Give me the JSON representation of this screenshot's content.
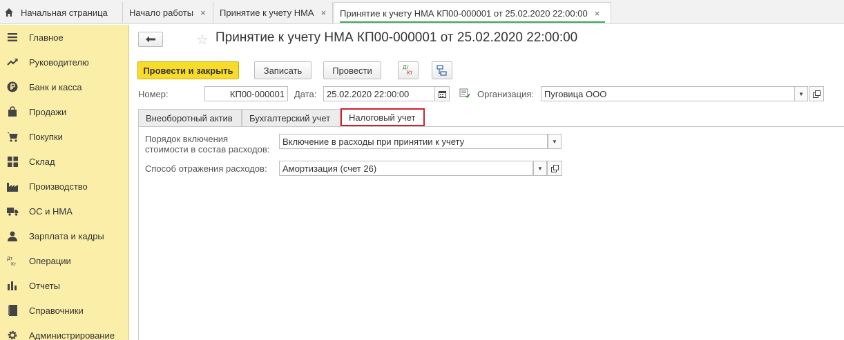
{
  "tabs": {
    "home": "Начальная страница",
    "start": "Начало работы",
    "acceptance": "Принятие к учету НМА",
    "current": "Принятие к учету НМА КП00-000001 от 25.02.2020 22:00:00",
    "close": "×"
  },
  "sidebar": {
    "items": [
      {
        "label": "Главное",
        "icon": "menu-icon"
      },
      {
        "label": "Руководителю",
        "icon": "trend-icon"
      },
      {
        "label": "Банк и касса",
        "icon": "ruble-icon"
      },
      {
        "label": "Продажи",
        "icon": "bag-icon"
      },
      {
        "label": "Покупки",
        "icon": "cart-icon"
      },
      {
        "label": "Склад",
        "icon": "grid-icon"
      },
      {
        "label": "Производство",
        "icon": "factory-icon"
      },
      {
        "label": "ОС и НМА",
        "icon": "truck-icon"
      },
      {
        "label": "Зарплата и кадры",
        "icon": "person-icon"
      },
      {
        "label": "Операции",
        "icon": "dt-kt-icon"
      },
      {
        "label": "Отчеты",
        "icon": "bar-chart-icon"
      },
      {
        "label": "Справочники",
        "icon": "book-icon"
      },
      {
        "label": "Администрирование",
        "icon": "gear-icon"
      }
    ]
  },
  "document": {
    "title": "Принятие к учету НМА КП00-000001 от 25.02.2020 22:00:00"
  },
  "toolbar": {
    "post_close": "Провести и закрыть",
    "save": "Записать",
    "post": "Провести",
    "dtkt_top": "Дт",
    "dtkt_bottom": "Кт"
  },
  "header_fields": {
    "number_label": "Номер:",
    "number_value": "КП00-000001",
    "date_label": "Дата:",
    "date_value": "25.02.2020 22:00:00",
    "org_label": "Организация:",
    "org_value": "Пуговица ООО"
  },
  "inner_tabs": [
    "Внеоборотный актив",
    "Бухгалтерский учет",
    "Налоговый учет"
  ],
  "tax": {
    "order_label_1": "Порядок включения",
    "order_label_2": "стоимости в состав расходов:",
    "order_value": "Включение в расходы при принятии к учету",
    "method_label": "Способ отражения расходов:",
    "method_value": "Амортизация (счет 26)"
  },
  "colors": {
    "sidebar_bg": "#fbeea8",
    "primary_button": "#f9dc2a",
    "active_tab_underline": "#3ba35c",
    "highlight_border": "#d0202a"
  }
}
